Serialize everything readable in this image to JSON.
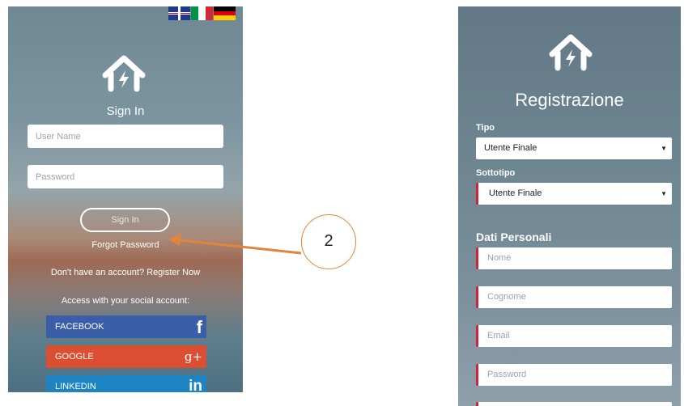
{
  "signin": {
    "title": "Sign In",
    "username_placeholder": "User Name",
    "password_placeholder": "Password",
    "signin_button": "Sign In",
    "forgot_password": "Forgot Password",
    "register_text": "Don't have an account? Register Now",
    "social_heading": "Access with your social account:",
    "social": {
      "facebook": "FACEBOOK",
      "google": "GOOGLE",
      "linkedin": "LINKEDIN"
    },
    "language_flags": [
      "uk-flag-icon",
      "italy-flag-icon",
      "germany-flag-icon"
    ],
    "colors": {
      "facebook": "#3b5ea8",
      "google": "#dc4e31",
      "linkedin": "#1d84c4"
    }
  },
  "callout": {
    "number": "2",
    "color": "#e1853d"
  },
  "registration": {
    "title": "Registrazione",
    "tipo_label": "Tipo",
    "tipo_value": "Utente Finale",
    "sottotipo_label": "Sottotipo",
    "sottotipo_value": "Utente Finale",
    "section_title": "Dati Personali",
    "fields": [
      "Nome",
      "Cognome",
      "Email",
      "Password"
    ],
    "required_color": "#d0223a"
  }
}
